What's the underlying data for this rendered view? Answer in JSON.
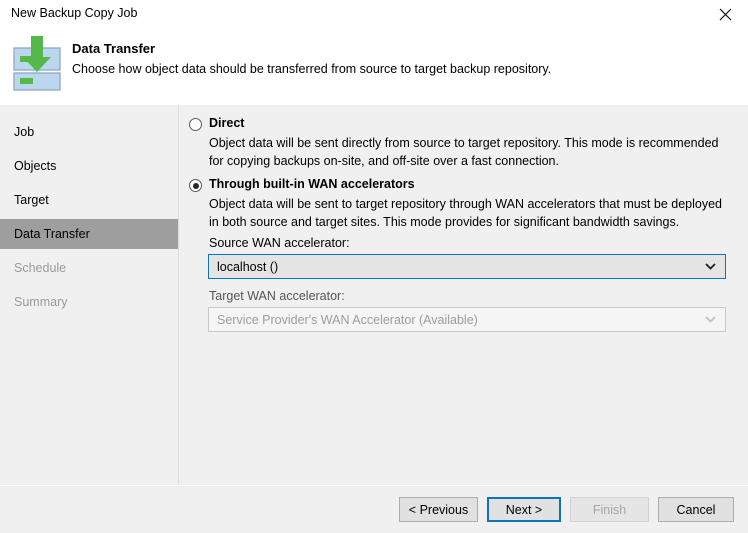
{
  "window": {
    "title": "New Backup Copy Job",
    "close_icon": "close-icon"
  },
  "header": {
    "icon": "backup-copy-download-icon",
    "title": "Data Transfer",
    "subtitle": "Choose how object data should be transferred from source to target backup repository."
  },
  "sidebar": {
    "items": [
      {
        "label": "Job",
        "state": "normal"
      },
      {
        "label": "Objects",
        "state": "normal"
      },
      {
        "label": "Target",
        "state": "normal"
      },
      {
        "label": "Data Transfer",
        "state": "selected"
      },
      {
        "label": "Schedule",
        "state": "disabled"
      },
      {
        "label": "Summary",
        "state": "disabled"
      }
    ]
  },
  "content": {
    "options": [
      {
        "id": "direct",
        "label": "Direct",
        "selected": false,
        "description": "Object data will be sent directly from source to target repository. This mode is recommended for copying backups on-site, and off-site over a fast connection."
      },
      {
        "id": "wan-accelerators",
        "label": "Through built-in WAN accelerators",
        "selected": true,
        "description": "Object data will be sent to target repository through WAN accelerators that must be deployed in both source and target sites. This mode provides for significant bandwidth savings."
      }
    ],
    "source_wan": {
      "label": "Source WAN accelerator:",
      "value": "localhost ()",
      "enabled": true,
      "focused": true
    },
    "target_wan": {
      "label": "Target WAN accelerator:",
      "value": "Service Provider's WAN Accelerator (Available)",
      "enabled": false,
      "focused": false
    }
  },
  "footer": {
    "previous_label": "< Previous",
    "next_label": "Next >",
    "finish_label": "Finish",
    "cancel_label": "Cancel"
  },
  "colors": {
    "accent": "#0a74bd",
    "panel": "#f0f0f0",
    "selection": "#9e9e9e",
    "icon_green": "#54b948",
    "icon_blue": "#bcd6ee"
  }
}
